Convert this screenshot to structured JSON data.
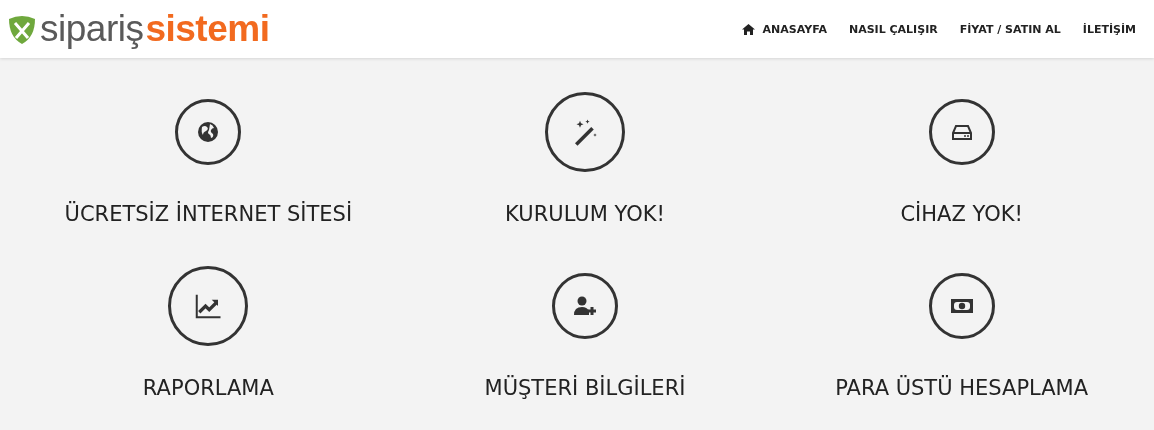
{
  "logo": {
    "part_1": "sipariş",
    "part_2": "sistemi"
  },
  "nav": [
    {
      "label": "ANASAYFA",
      "kind": "home"
    },
    {
      "label": "NASIL ÇALIŞIR",
      "kind": "plain"
    },
    {
      "label": "FİYAT / SATIN AL",
      "kind": "plain"
    },
    {
      "label": "İLETİŞİM",
      "kind": "plain"
    }
  ],
  "features": [
    {
      "title": "ÜCRETSİZ İNTERNET SİTESİ",
      "highlighted": false
    },
    {
      "title": "KURULUM YOK!",
      "highlighted": true
    },
    {
      "title": "CİHAZ YOK!",
      "highlighted": false
    },
    {
      "title": "RAPORLAMA",
      "highlighted": true
    },
    {
      "title": "MÜŞTERİ BİLGİLERİ",
      "highlighted": false
    },
    {
      "title": "PARA ÜSTÜ HESAPLAMA",
      "highlighted": false
    }
  ]
}
